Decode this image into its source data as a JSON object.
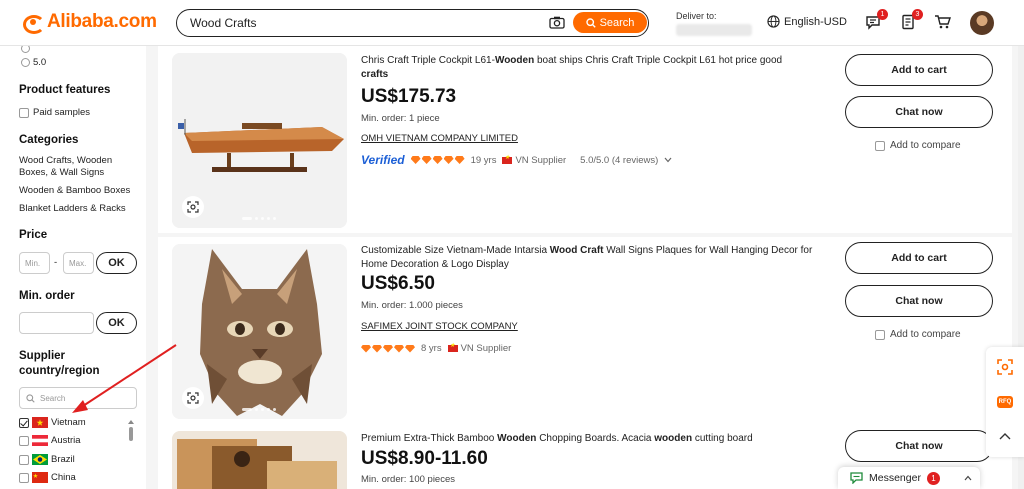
{
  "header": {
    "logo_text": "Alibaba.com",
    "search_value": "Wood Crafts",
    "search_button": "Search",
    "deliver_label": "Deliver to:",
    "language": "English-USD",
    "messages_badge": "1",
    "orders_badge": "3"
  },
  "sidebar": {
    "rating_label": "5.0",
    "product_features_heading": "Product features",
    "paid_samples": "Paid samples",
    "categories_heading": "Categories",
    "categories": [
      "Wood Crafts, Wooden",
      "Boxes, & Wall Signs",
      "Wooden & Bamboo Boxes",
      "Blanket Ladders & Racks"
    ],
    "price_heading": "Price",
    "price_min_placeholder": "Min.",
    "price_max_placeholder": "Max.",
    "price_dash": "-",
    "ok_label": "OK",
    "min_order_heading": "Min. order",
    "supplier_heading_1": "Supplier",
    "supplier_heading_2": "country/region",
    "country_search_placeholder": "Search",
    "countries": [
      {
        "name": "Vietnam",
        "checked": true
      },
      {
        "name": "Austria",
        "checked": false
      },
      {
        "name": "Brazil",
        "checked": false
      },
      {
        "name": "China",
        "checked": false
      }
    ]
  },
  "products": [
    {
      "title_pre": "Chris Craft Triple Cockpit L61-",
      "title_bold": "Wooden",
      "title_post": " boat ships Chris Craft Triple Cockpit L61 hot price good",
      "title_bold2": "crafts",
      "price": "US$175.73",
      "min_order": "Min. order: 1 piece",
      "company": "OMH VIETNAM COMPANY LIMITED",
      "verified": "Verified",
      "years": "19 yrs",
      "supplier": "VN Supplier",
      "rating": "5.0/5.0 (4 reviews)"
    },
    {
      "title_pre": "Customizable Size Vietnam-Made Intarsia ",
      "title_bold": "Wood Craft",
      "title_post": " Wall Signs Plaques for Wall Hanging Decor for Home Decoration & Logo Display",
      "price": "US$6.50",
      "min_order": "Min. order: 1.000 pieces",
      "company": "SAFIMEX JOINT STOCK COMPANY",
      "years": "8 yrs",
      "supplier": "VN Supplier"
    },
    {
      "title_pre": "Premium Extra-Thick Bamboo ",
      "title_bold": "Wooden",
      "title_mid": " Chopping Boards. Acacia ",
      "title_bold2": "wooden",
      "title_post": " cutting board",
      "price": "US$8.90-11.60",
      "min_order": "Min. order: 100 pieces"
    }
  ],
  "actions": {
    "add_to_cart": "Add to cart",
    "chat_now": "Chat now",
    "add_to_compare": "Add to compare"
  },
  "messenger": {
    "label": "Messenger",
    "badge": "1"
  },
  "float_tools": {
    "rfq_label": "RFQ"
  },
  "colors": {
    "brand": "#ff6a00",
    "badge": "#e02020",
    "verified": "#1c5fd6",
    "annotation_arrow": "#e02020"
  }
}
